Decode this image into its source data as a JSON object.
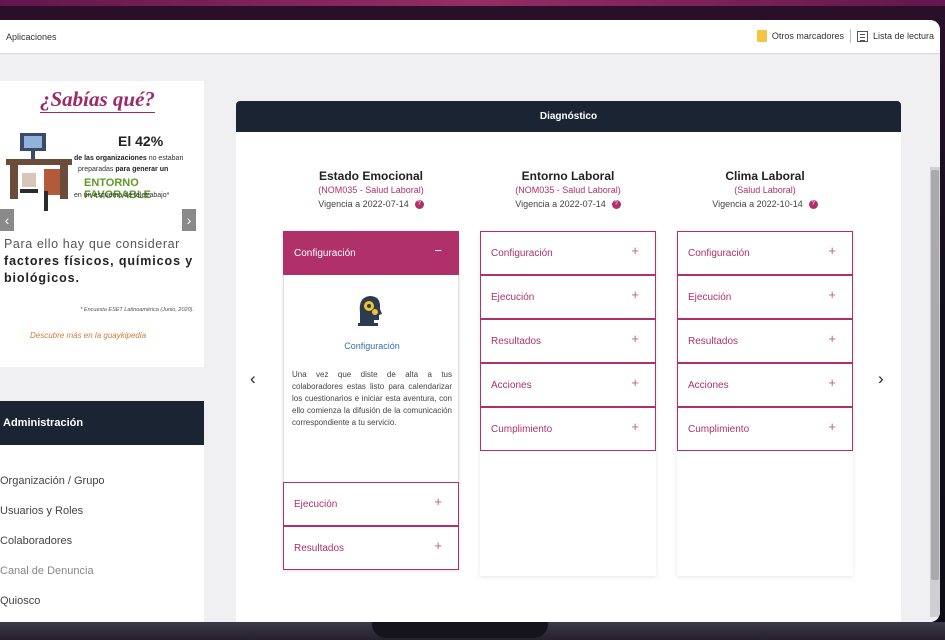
{
  "browser": {
    "bookmarks": {
      "apps_label": "Aplicaciones",
      "other_bookmarks": "Otros marcadores",
      "reading_list": "Lista de lectura"
    }
  },
  "ad": {
    "title": "¿Sabías qué?",
    "percent": "El 42%",
    "line1_bold": "de las organizaciones",
    "line1_rest": " no estaban",
    "line2": "preparadas",
    "line2_bold": " para generar un",
    "highlight": "ENTORNO FAVORABLE",
    "line3": "en un esquema de teletrabajo*",
    "big1": "Para ello hay que considerar",
    "big2": "factores físicos, químicos y",
    "big3": "biológicos.",
    "source": "* Encuesta ESET Latinoamérica (Junio, 2020).",
    "cta": "Descubre más en la guaykipedia"
  },
  "admin": {
    "header": "Administración",
    "items": [
      "Organización / Grupo",
      "Usuarios y Roles",
      "Colaboradores",
      "Canal de Denuncia",
      "Quiosco"
    ]
  },
  "diagnostico": {
    "header": "Diagnóstico",
    "info_glyph": "?",
    "columns": [
      {
        "title": "Estado Emocional",
        "subtitle": "(NOM035 - Salud Laboral)",
        "vigencia": "Vigencia a 2022-07-14",
        "open_panel": {
          "label": "Configuración",
          "figure_caption": "Configuración",
          "text": "Una vez que diste de alta a tus colaboradores estas listo para calendarizar los cuestionarios e iniciar esta aventura, con ello comienza la difusión de la comunicación correspondiente a tu servicio."
        },
        "items": [
          "Ejecución",
          "Resultados"
        ]
      },
      {
        "title": "Entorno Laboral",
        "subtitle": "(NOM035 - Salud Laboral)",
        "vigencia": "Vigencia a 2022-07-14",
        "items": [
          "Configuración",
          "Ejecución",
          "Resultados",
          "Acciones",
          "Cumplimiento"
        ]
      },
      {
        "title": "Clima Laboral",
        "subtitle": "(Salud Laboral)",
        "vigencia": "Vigencia a 2022-10-14",
        "items": [
          "Configuración",
          "Ejecución",
          "Resultados",
          "Acciones",
          "Cumplimiento"
        ]
      }
    ],
    "nav_prev": "‹",
    "nav_next": "›",
    "collapse_sign": "−",
    "expand_sign": "+"
  },
  "colors": {
    "accent": "#b0306a",
    "header_dark": "#1a2433",
    "green": "#5d9a2a"
  }
}
